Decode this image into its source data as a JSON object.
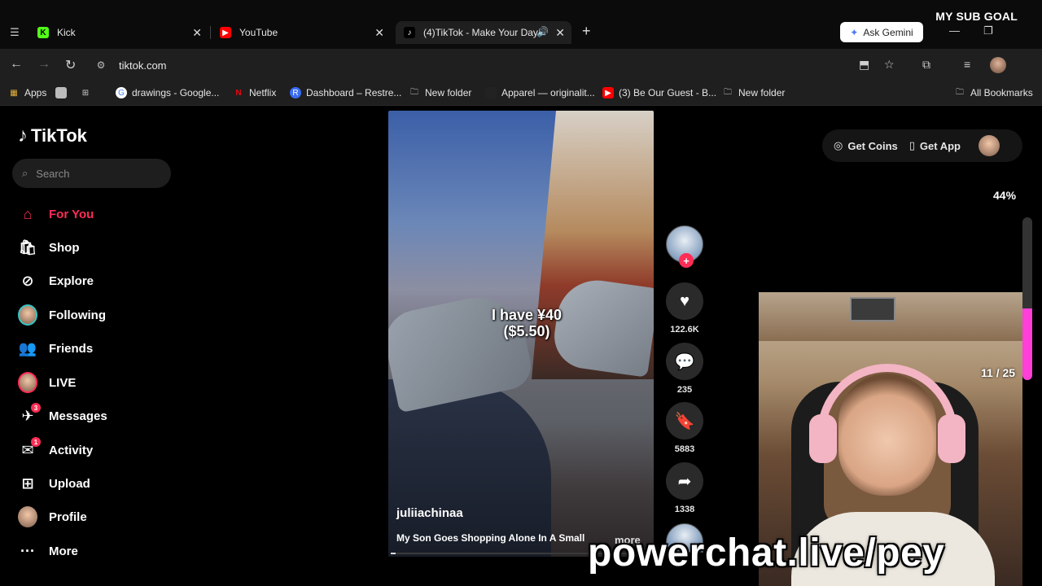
{
  "overlay": {
    "sub_goal": "MY SUB GOAL",
    "goal_percent": "44%",
    "goal_fill_fraction": 0.44,
    "page_count": "11 / 25",
    "handle": "powerchat.live/pey"
  },
  "browser": {
    "tabs": [
      {
        "label": "Kick",
        "active": false
      },
      {
        "label": "YouTube",
        "active": false
      },
      {
        "label": "(4)TikTok - Make Your Day",
        "active": true
      }
    ],
    "ask_gemini": "Ask Gemini",
    "url": "tiktok.com",
    "bookmarks": [
      "Apps",
      "drawings - Google...",
      "Netflix",
      "Dashboard – Restre...",
      "New folder",
      "Apparel — originalit...",
      "(3) Be Our Guest - B...",
      "New folder",
      "All Bookmarks"
    ]
  },
  "tiktok": {
    "logo": "TikTok",
    "search_placeholder": "Search",
    "nav": [
      {
        "label": "For You",
        "icon": "home-icon"
      },
      {
        "label": "Shop",
        "icon": "shop-icon"
      },
      {
        "label": "Explore",
        "icon": "compass-icon"
      },
      {
        "label": "Following",
        "icon": "following-avatar"
      },
      {
        "label": "Friends",
        "icon": "friends-icon"
      },
      {
        "label": "LIVE",
        "icon": "live-avatar"
      },
      {
        "label": "Messages",
        "icon": "messages-icon",
        "badge": "3"
      },
      {
        "label": "Activity",
        "icon": "activity-icon",
        "badge": "1"
      },
      {
        "label": "Upload",
        "icon": "upload-icon"
      },
      {
        "label": "Profile",
        "icon": "profile-avatar"
      },
      {
        "label": "More",
        "icon": "more-icon"
      }
    ],
    "get_coins": "Get Coins",
    "get_app": "Get App",
    "video": {
      "caption_line1": "I have ¥40",
      "caption_line2": "($5.50)",
      "username": "juliiachinaa",
      "description": "My Son Goes Shopping Alone In A Small",
      "more": "more",
      "progress_fraction": 0.02
    },
    "actions": {
      "likes": "122.6K",
      "comments": "235",
      "saves": "5883",
      "shares": "1338"
    }
  },
  "colors": {
    "accent": "#ff2c55",
    "goal": "#ff3fd8"
  }
}
